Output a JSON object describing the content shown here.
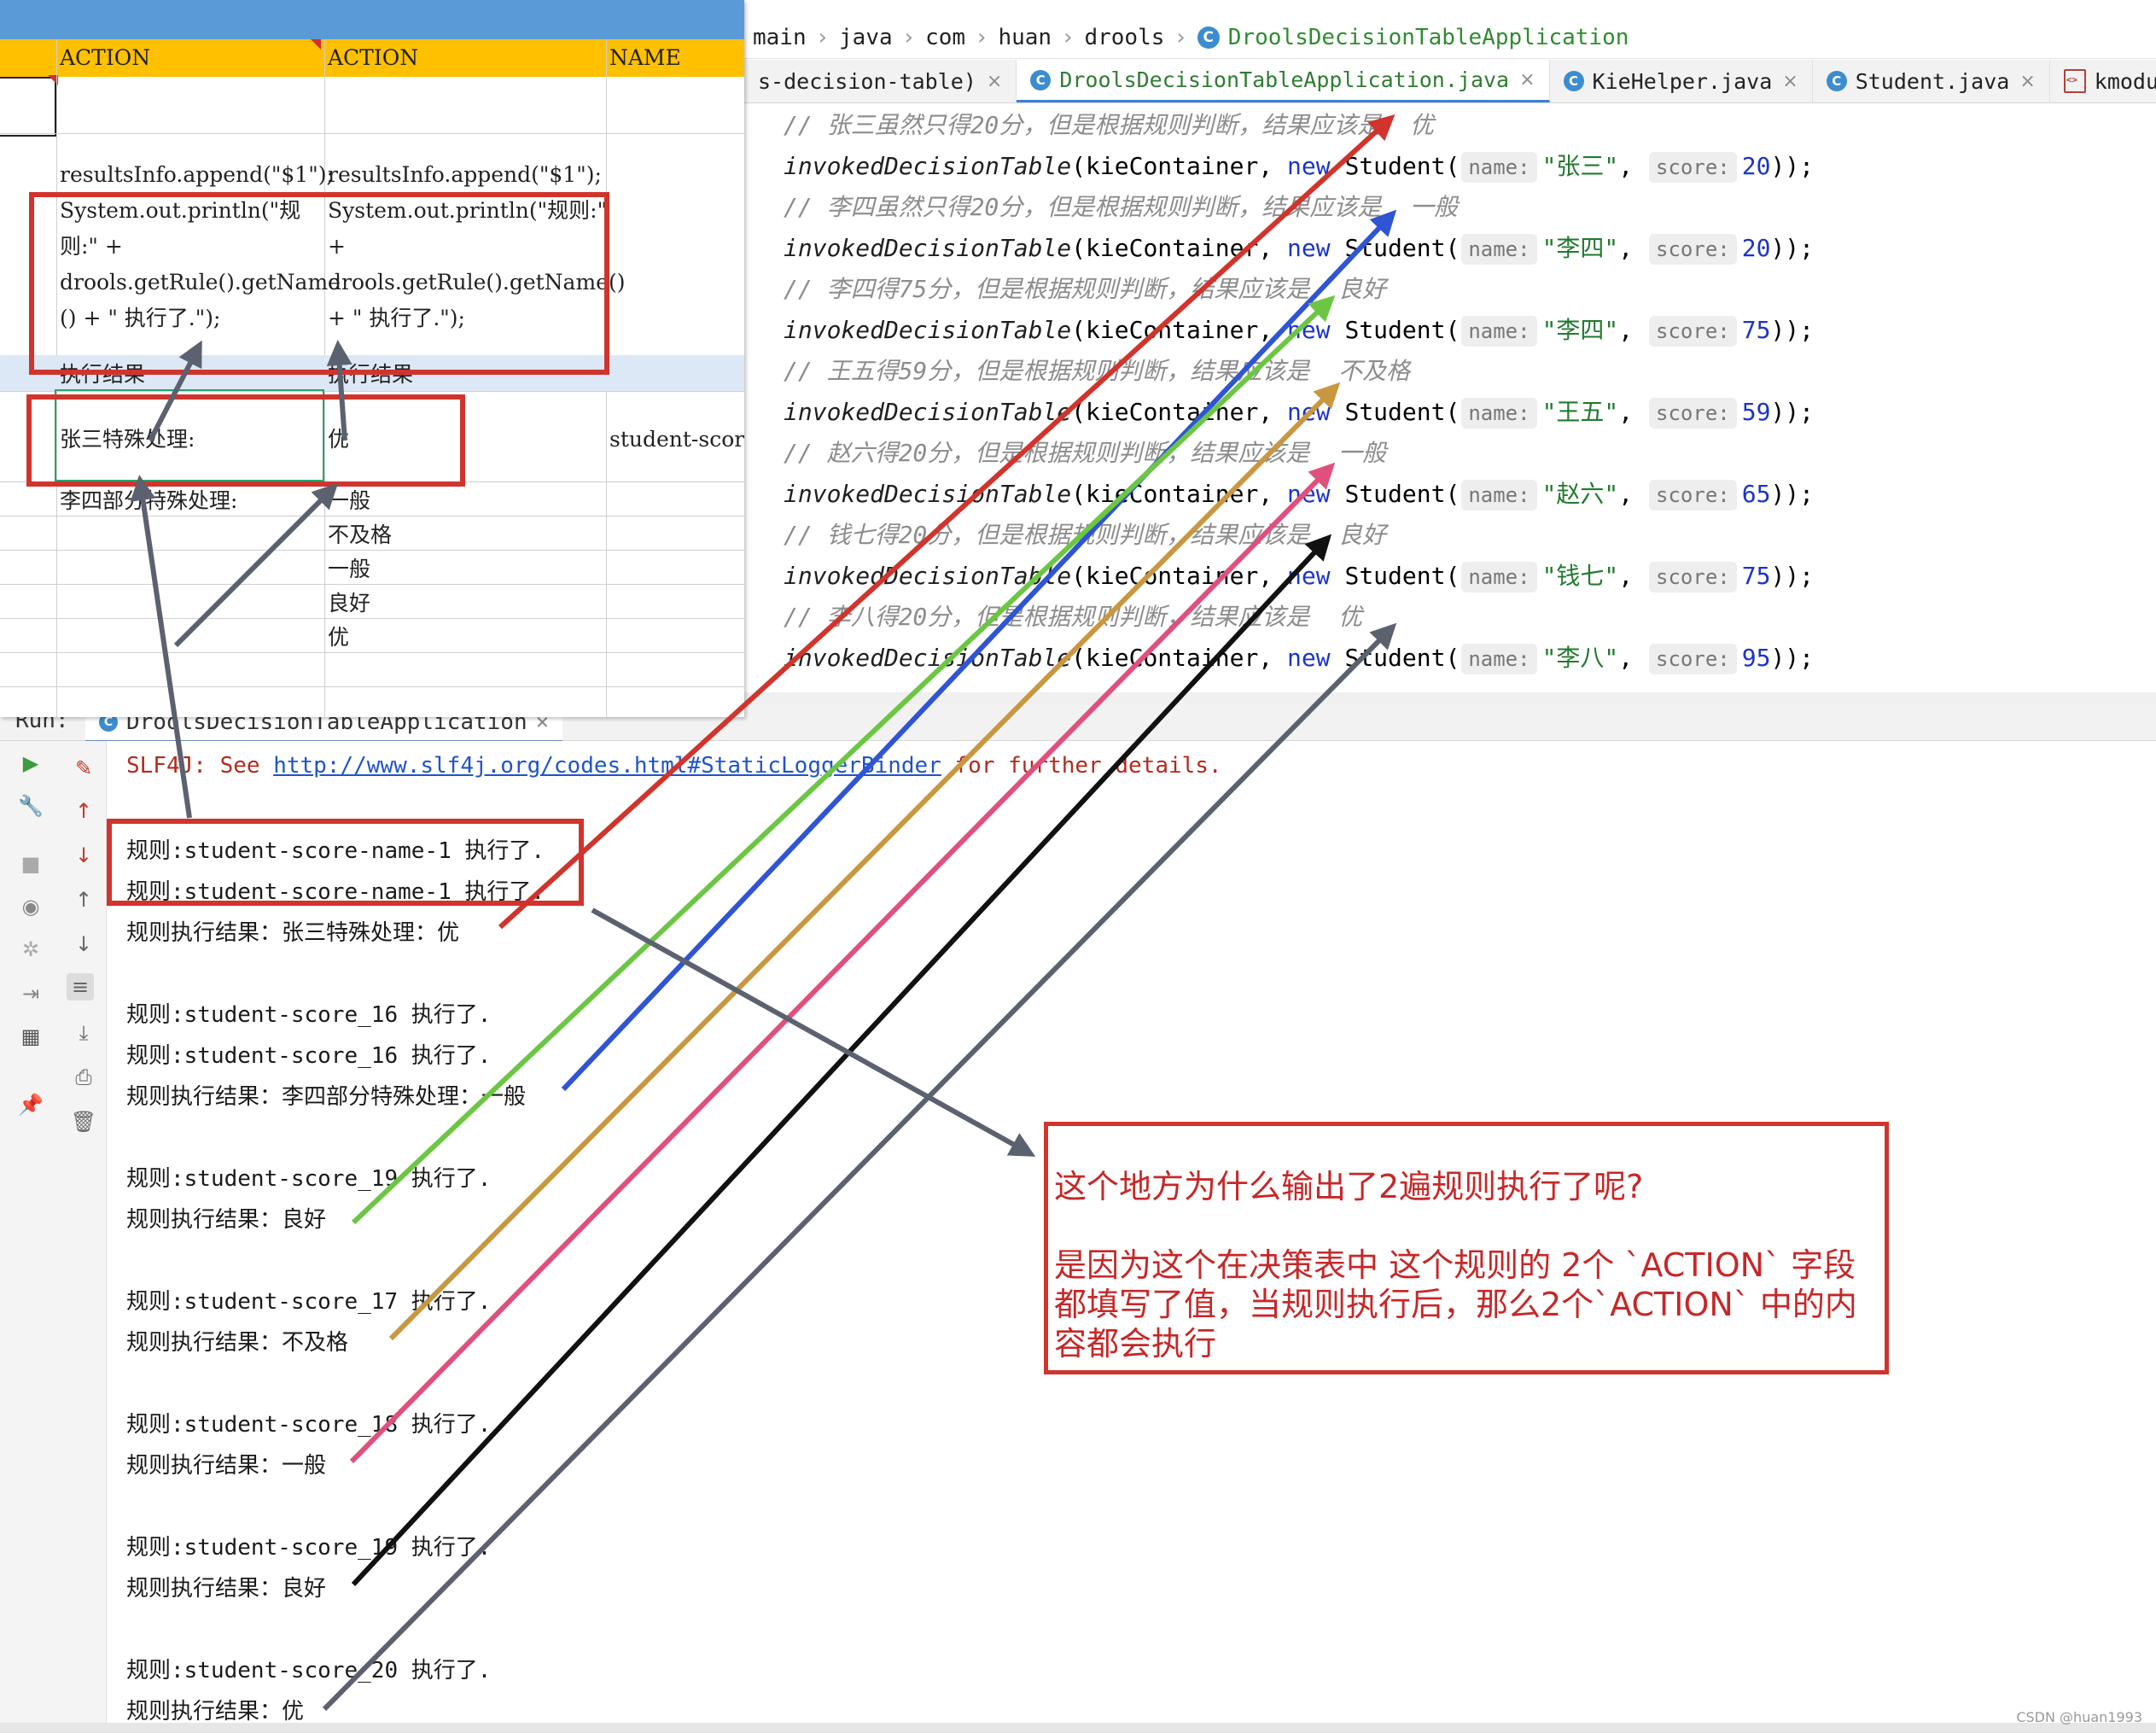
{
  "breadcrumb": {
    "items": [
      "main",
      "java",
      "com",
      "huan",
      "drools"
    ],
    "class_name": "DroolsDecisionTableApplication"
  },
  "tabs": [
    {
      "label": "s-decision-table)"
    },
    {
      "label": "DroolsDecisionTableApplication.java",
      "active": true
    },
    {
      "label": "KieHelper.java"
    },
    {
      "label": "Student.java"
    },
    {
      "label": "kmodule.xml"
    }
  ],
  "code": {
    "fn": "invokedDecisionTable",
    "container": "kieContainer, ",
    "new_kw": "new",
    "student_cls": "Student(",
    "name_hint": "name:",
    "score_hint": "score:",
    "lines": [
      {
        "comment": "// 张三虽然只得20分，但是根据规则判断，结果应该是  优",
        "name": "\"张三\"",
        "score": "20"
      },
      {
        "comment": "// 李四虽然只得20分，但是根据规则判断，结果应该是  一般",
        "name": "\"李四\"",
        "score": "20"
      },
      {
        "comment": "// 李四得75分，但是根据规则判断，结果应该是  良好",
        "name": "\"李四\"",
        "score": "75"
      },
      {
        "comment": "// 王五得59分，但是根据规则判断，结果应该是  不及格",
        "name": "\"王五\"",
        "score": "59"
      },
      {
        "comment": "// 赵六得20分，但是根据规则判断，结果应该是  一般",
        "name": "\"赵六\"",
        "score": "65"
      },
      {
        "comment": "// 钱七得20分，但是根据规则判断，结果应该是  良好",
        "name": "\"钱七\"",
        "score": "75"
      },
      {
        "comment": "// 李八得20分，但是根据规则判断，结果应该是  优",
        "name": "\"李八\"",
        "score": "95"
      }
    ]
  },
  "run": {
    "label": "Run:",
    "tab": "DroolsDecisionTableApplication"
  },
  "console": {
    "slf_prefix": "SLF4J: See ",
    "slf_link": "http://www.slf4j.org/codes.html#StaticLoggerBinder",
    "slf_suffix": " for further details.",
    "lines": [
      "规则:student-score-name-1 执行了.",
      "规则:student-score-name-1 执行了.",
      "规则执行结果：张三特殊处理：优",
      "规则:student-score_16 执行了.",
      "规则:student-score_16 执行了.",
      "规则执行结果：李四部分特殊处理：一般",
      "规则:student-score_19 执行了.",
      "规则执行结果：良好",
      "规则:student-score_17 执行了.",
      "规则执行结果：不及格",
      "规则:student-score_18 执行了.",
      "规则执行结果：一般",
      "规则:student-score_19 执行了.",
      "规则执行结果：良好",
      "规则:student-score_20 执行了.",
      "规则执行结果：优"
    ]
  },
  "sheet": {
    "headers": [
      "ACTION",
      "ACTION",
      "NAME"
    ],
    "action1_code": [
      "resultsInfo.append(\"$1\");",
      "System.out.println(\"规",
      "则:\" +",
      "drools.getRule().getName",
      "() + \" 执行了.\");"
    ],
    "action2_code": [
      "resultsInfo.append(\"$1\");",
      "System.out.println(\"规则:\"",
      "+",
      "drools.getRule().getName()",
      "+ \" 执行了.\");"
    ],
    "exec_label": "执行结果",
    "rows": [
      {
        "a": "张三特殊处理:",
        "b": "优",
        "c": "student-score"
      },
      {
        "a": "李四部分特殊处理:",
        "b": "一般",
        "c": ""
      },
      {
        "a": "",
        "b": "不及格",
        "c": ""
      },
      {
        "a": "",
        "b": "一般",
        "c": ""
      },
      {
        "a": "",
        "b": "良好",
        "c": ""
      },
      {
        "a": "",
        "b": "优",
        "c": ""
      }
    ]
  },
  "note": {
    "question": "这个地方为什么输出了2遍规则执行了呢?",
    "answer": "是因为这个在决策表中 这个规则的 2个 `ACTION` 字段都填写了值，当规则执行后，那么2个`ACTION` 中的内容都会执行"
  },
  "watermark": "CSDN @huan1993",
  "colors": {
    "note_red": "#d0342c",
    "arrow_green": "#6cc644",
    "arrow_blue": "#2f54d4",
    "arrow_gold": "#c9973f",
    "arrow_pink": "#e0507c",
    "arrow_black": "#111111",
    "arrow_gray": "#5c6170",
    "sheet_header": "#ffc000",
    "sheet_topbar": "#5b9bd5"
  }
}
